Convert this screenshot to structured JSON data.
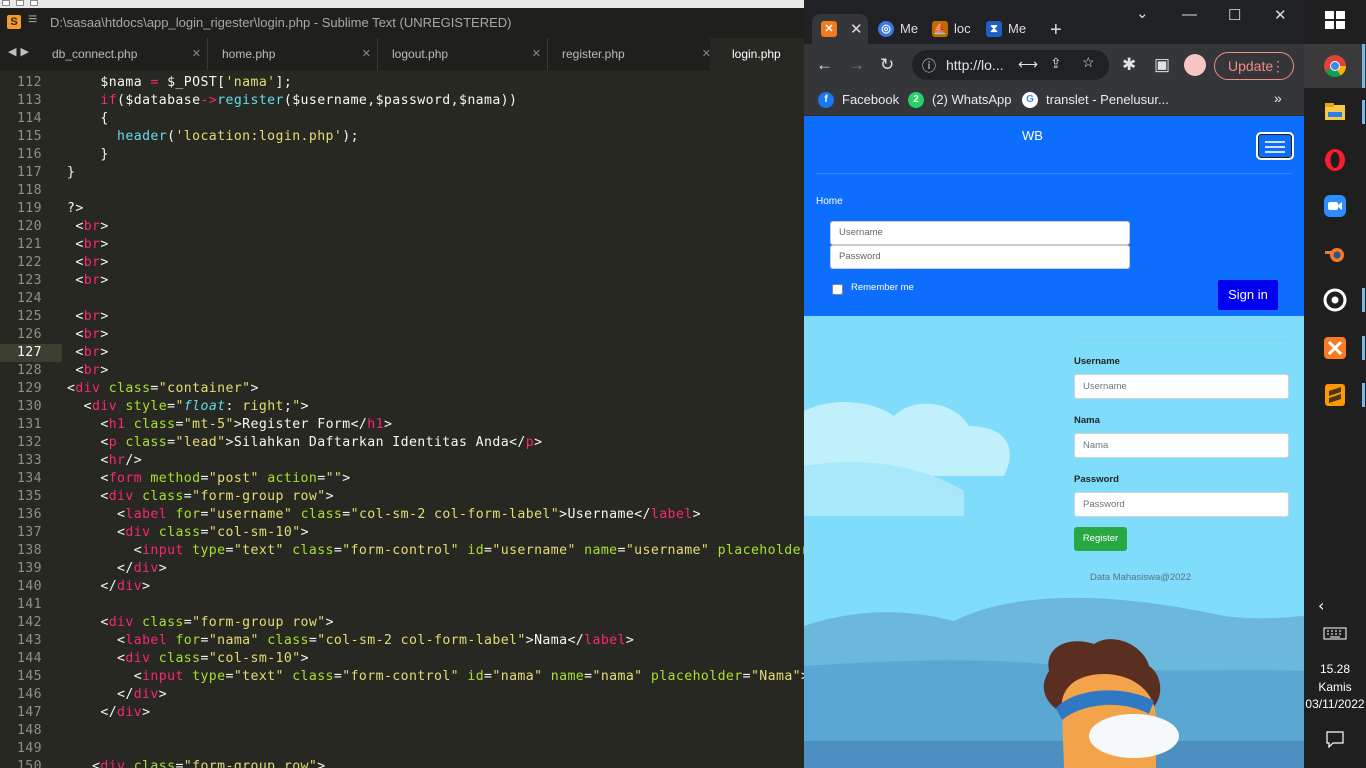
{
  "sublime": {
    "title": "D:\\sasaa\\htdocs\\app_login_rigester\\login.php - Sublime Text (UNREGISTERED)",
    "tabs": [
      "db_connect.php",
      "home.php",
      "logout.php",
      "register.php",
      "login.php"
    ],
    "active_tab": "login.php",
    "current_line": "127",
    "line_numbers": [
      "112",
      "113",
      "114",
      "115",
      "116",
      "117",
      "118",
      "119",
      "120",
      "121",
      "122",
      "123",
      "124",
      "125",
      "126",
      "127",
      "128",
      "129",
      "130",
      "131",
      "132",
      "133",
      "134",
      "135",
      "136",
      "137",
      "138",
      "139",
      "140",
      "141",
      "142",
      "143",
      "144",
      "145",
      "146",
      "147",
      "148",
      "149",
      "150"
    ]
  },
  "chrome": {
    "tab_labels": [
      "Me",
      "loc",
      "Me"
    ],
    "address": "http://lo...",
    "update_label": "Update",
    "bookmarks": [
      "Facebook",
      "(2) WhatsApp",
      "translet - Penelusur..."
    ],
    "bookmark_badge": "2",
    "page": {
      "brand": "WB",
      "home_link": "Home",
      "username_placeholder": "Username",
      "password_placeholder": "Password",
      "remember_label": "Remember me",
      "signin_label": "Sign in",
      "form": {
        "username_label": "Username",
        "username_placeholder": "Username",
        "nama_label": "Nama",
        "nama_placeholder": "Nama",
        "password_label": "Password",
        "password_placeholder": "Password",
        "register_label": "Register"
      },
      "footer": "Data Mahasiswa@2022"
    }
  },
  "taskbar": {
    "time": "15.28",
    "day": "Kamis",
    "date": "03/11/2022"
  },
  "colors": {
    "editor_bg": "#272822",
    "navbar_blue": "#0d6efd",
    "signin_blue": "#0000ee",
    "register_green": "#28a745",
    "sky": "#7fdcfa"
  }
}
